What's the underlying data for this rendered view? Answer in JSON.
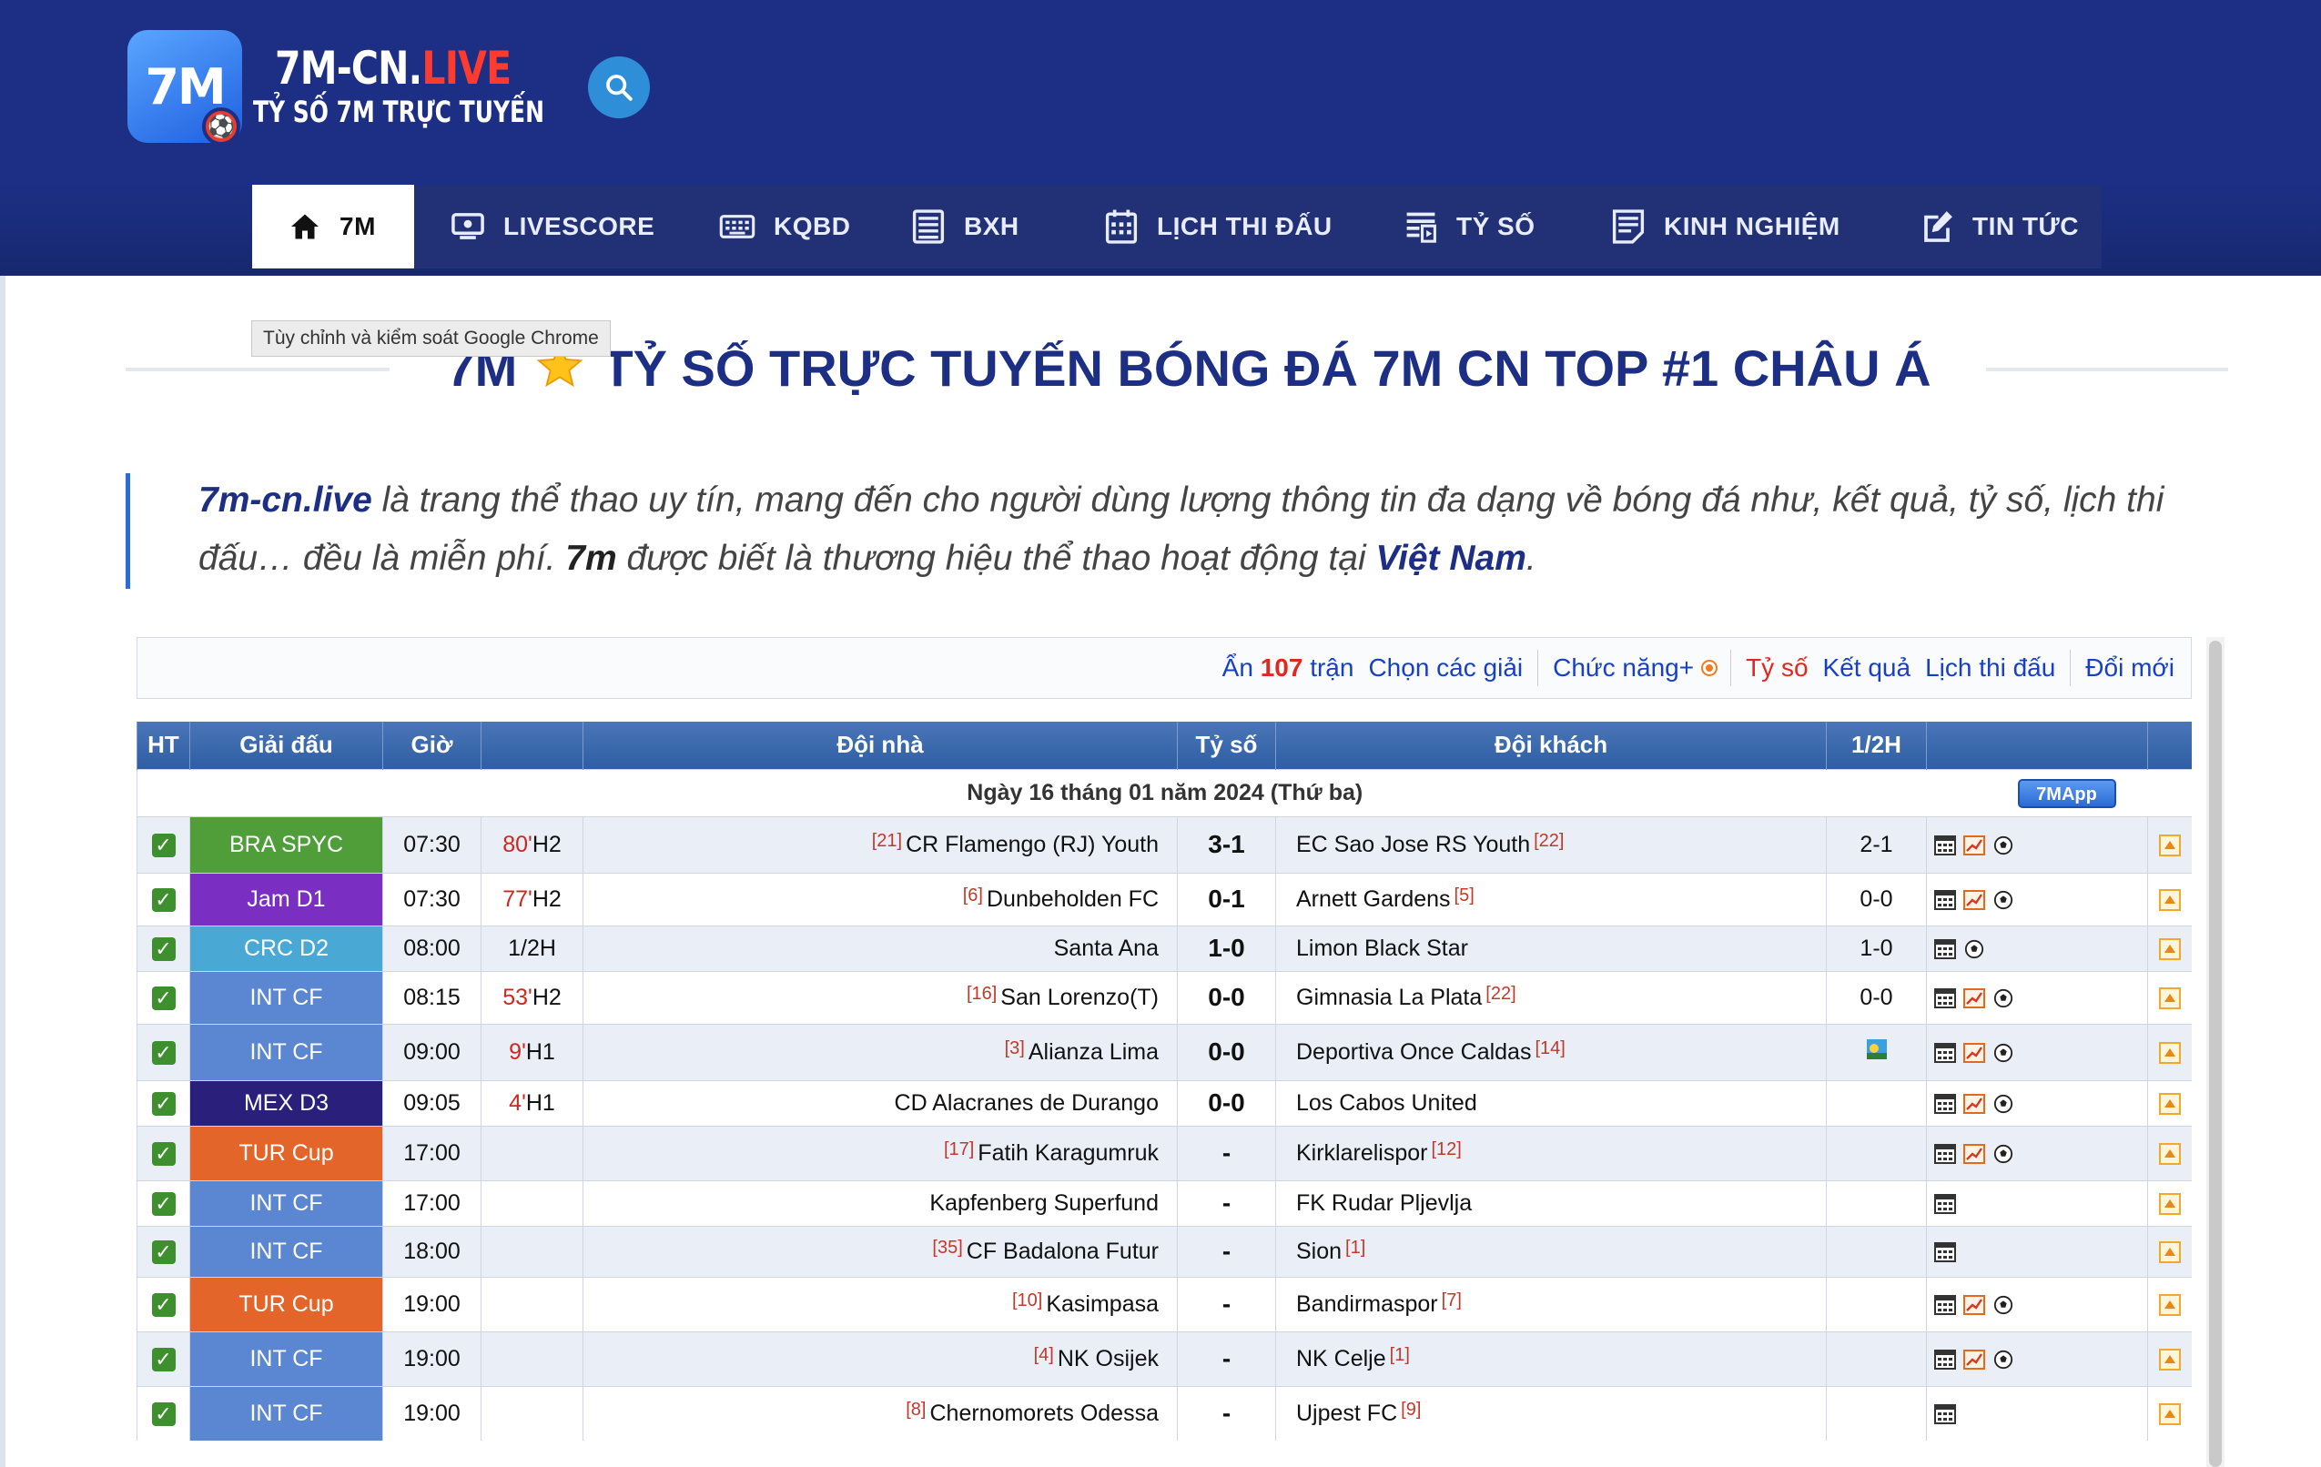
{
  "brand": {
    "logo_mark": "7M",
    "name_main": "7M-CN.",
    "name_accent": "LIVE",
    "subtitle": "TỶ SỐ 7M TRỰC TUYẾN"
  },
  "nav": [
    {
      "label": "7M",
      "icon": "home-icon",
      "active": true
    },
    {
      "label": "LIVESCORE",
      "icon": "monitor-icon"
    },
    {
      "label": "KQBD",
      "icon": "keyboard-icon"
    },
    {
      "label": "BXH",
      "icon": "list-icon"
    },
    {
      "label": "LỊCH THI ĐẤU",
      "icon": "calendar-icon"
    },
    {
      "label": "TỶ SỐ",
      "icon": "scoreboard-icon"
    },
    {
      "label": "KINH NGHIỆM",
      "icon": "document-icon"
    },
    {
      "label": "TIN TỨC",
      "icon": "edit-icon"
    }
  ],
  "tooltip": "Tùy chỉnh và kiểm soát Google Chrome",
  "page_title": {
    "prefix": "7M",
    "rest": "TỶ SỐ TRỰC TUYẾN BÓNG ĐÁ 7M CN TOP #1 CHÂU Á",
    "icon": "star-icon"
  },
  "intro": {
    "site": "7m-cn.live",
    "text1": " là trang thể thao uy tín, mang đến cho người dùng lượng thông tin đa dạng về bóng đá như, kết quả, tỷ số, lịch thi đấu… đều là miễn phí. ",
    "brand": "7m",
    "text2": " được biết là thương hiệu thể thao hoạt động tại ",
    "country": "Việt Nam",
    "end": "."
  },
  "toolbar": {
    "hide_prefix": "Ẩn",
    "hide_count": "107",
    "hide_suffix": "trận",
    "choose_league": "Chọn các giải",
    "functions": "Chức năng+",
    "score": "Tỷ số",
    "results": "Kết quả",
    "schedule": "Lịch thi đấu",
    "refresh": "Đổi mới"
  },
  "table": {
    "headers": {
      "ht": "HT",
      "league": "Giải đấu",
      "time": "Giờ",
      "status": "",
      "home": "Đội nhà",
      "score": "Tỷ số",
      "away": "Đội khách",
      "half": "1/2H",
      "icons": "",
      "last": ""
    },
    "date_label": "Ngày 16 tháng 01 năm 2024 (Thứ ba)",
    "app_badge": "7MApp",
    "league_colors": {
      "BRA SPYC": "#4f9e3a",
      "Jam D1": "#7a2fc2",
      "CRC D2": "#4aa9d4",
      "INT CF": "#5b86d2",
      "MEX D3": "#2a1f7a",
      "TUR Cup": "#e4652a"
    },
    "rows": [
      {
        "league": "BRA SPYC",
        "time": "07:30",
        "min": "80'",
        "phase": "H2",
        "home_rank": "[21]",
        "home": "CR Flamengo (RJ) Youth",
        "score": "3-1",
        "away": "EC Sao Jose RS Youth",
        "away_rank": "[22]",
        "half": "2-1",
        "icons": [
          "odds",
          "chart",
          "ball"
        ]
      },
      {
        "league": "Jam D1",
        "time": "07:30",
        "min": "77'",
        "phase": "H2",
        "home_rank": "[6]",
        "home": "Dunbeholden FC",
        "score": "0-1",
        "away": "Arnett Gardens",
        "away_rank": "[5]",
        "half": "0-0",
        "icons": [
          "odds",
          "chart",
          "ball"
        ]
      },
      {
        "league": "CRC D2",
        "time": "08:00",
        "min": "",
        "phase": "1/2H",
        "home_rank": "",
        "home": "Santa Ana",
        "score": "1-0",
        "away": "Limon Black Star",
        "away_rank": "",
        "half": "1-0",
        "icons": [
          "odds",
          "ball"
        ]
      },
      {
        "league": "INT CF",
        "time": "08:15",
        "min": "53'",
        "phase": "H2",
        "home_rank": "[16]",
        "home": "San Lorenzo(T)",
        "score": "0-0",
        "away": "Gimnasia La Plata",
        "away_rank": "[22]",
        "half": "0-0",
        "icons": [
          "odds",
          "chart",
          "ball"
        ]
      },
      {
        "league": "INT CF",
        "time": "09:00",
        "min": "9'",
        "phase": "H1",
        "home_rank": "[3]",
        "home": "Alianza Lima",
        "score": "0-0",
        "away": "Deportiva Once Caldas",
        "away_rank": "[14]",
        "half": "",
        "half_icon": "weather-icon",
        "icons": [
          "odds",
          "chart",
          "ball"
        ]
      },
      {
        "league": "MEX D3",
        "time": "09:05",
        "min": "4'",
        "phase": "H1",
        "home_rank": "",
        "home": "CD Alacranes de Durango",
        "score": "0-0",
        "away": "Los Cabos United",
        "away_rank": "",
        "half": "",
        "icons": [
          "odds",
          "chart",
          "ball"
        ]
      },
      {
        "league": "TUR Cup",
        "time": "17:00",
        "min": "",
        "phase": "",
        "home_rank": "[17]",
        "home": "Fatih Karagumruk",
        "score": "-",
        "away": "Kirklarelispor",
        "away_rank": "[12]",
        "half": "",
        "icons": [
          "odds",
          "chart",
          "ball"
        ]
      },
      {
        "league": "INT CF",
        "time": "17:00",
        "min": "",
        "phase": "",
        "home_rank": "",
        "home": "Kapfenberg Superfund",
        "score": "-",
        "away": "FK Rudar Pljevlja",
        "away_rank": "",
        "half": "",
        "icons": [
          "odds"
        ]
      },
      {
        "league": "INT CF",
        "time": "18:00",
        "min": "",
        "phase": "",
        "home_rank": "[35]",
        "home": "CF Badalona Futur",
        "score": "-",
        "away": "Sion",
        "away_rank": "[1]",
        "half": "",
        "icons": [
          "odds"
        ]
      },
      {
        "league": "TUR Cup",
        "time": "19:00",
        "min": "",
        "phase": "",
        "home_rank": "[10]",
        "home": "Kasimpasa",
        "score": "-",
        "away": "Bandirmaspor",
        "away_rank": "[7]",
        "half": "",
        "icons": [
          "odds",
          "chart",
          "ball"
        ]
      },
      {
        "league": "INT CF",
        "time": "19:00",
        "min": "",
        "phase": "",
        "home_rank": "[4]",
        "home": "NK Osijek",
        "score": "-",
        "away": "NK Celje",
        "away_rank": "[1]",
        "half": "",
        "icons": [
          "odds",
          "chart",
          "ball"
        ]
      },
      {
        "league": "INT CF",
        "time": "19:00",
        "min": "",
        "phase": "",
        "home_rank": "[8]",
        "home": "Chernomorets Odessa",
        "score": "-",
        "away": "Ujpest FC",
        "away_rank": "[9]",
        "half": "",
        "icons": [
          "odds"
        ]
      }
    ]
  }
}
